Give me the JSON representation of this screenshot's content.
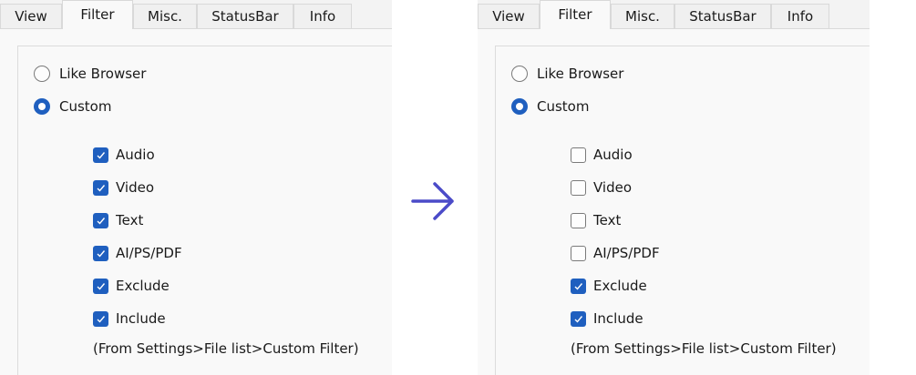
{
  "tabs": [
    {
      "label": "View",
      "active": false
    },
    {
      "label": "Filter",
      "active": true
    },
    {
      "label": "Misc.",
      "active": false
    },
    {
      "label": "StatusBar",
      "active": false
    },
    {
      "label": "Info",
      "active": false
    }
  ],
  "before": {
    "radios": [
      {
        "label": "Like Browser",
        "checked": false
      },
      {
        "label": "Custom",
        "checked": true
      }
    ],
    "checkboxes": [
      {
        "label": "Audio",
        "checked": true
      },
      {
        "label": "Video",
        "checked": true
      },
      {
        "label": "Text",
        "checked": true
      },
      {
        "label": "AI/PS/PDF",
        "checked": true
      },
      {
        "label": "Exclude",
        "checked": true
      },
      {
        "label": "Include",
        "checked": true
      }
    ],
    "note": "(From Settings>File list>Custom Filter)"
  },
  "after": {
    "radios": [
      {
        "label": "Like Browser",
        "checked": false
      },
      {
        "label": "Custom",
        "checked": true
      }
    ],
    "checkboxes": [
      {
        "label": "Audio",
        "checked": false
      },
      {
        "label": "Video",
        "checked": false
      },
      {
        "label": "Text",
        "checked": false
      },
      {
        "label": "AI/PS/PDF",
        "checked": false
      },
      {
        "label": "Exclude",
        "checked": true
      },
      {
        "label": "Include",
        "checked": true
      }
    ],
    "note": "(From Settings>File list>Custom Filter)"
  },
  "arrow": {
    "icon": "arrow-right-icon",
    "color": "#4b4bc8"
  },
  "colors": {
    "accent": "#1f5fbf"
  }
}
